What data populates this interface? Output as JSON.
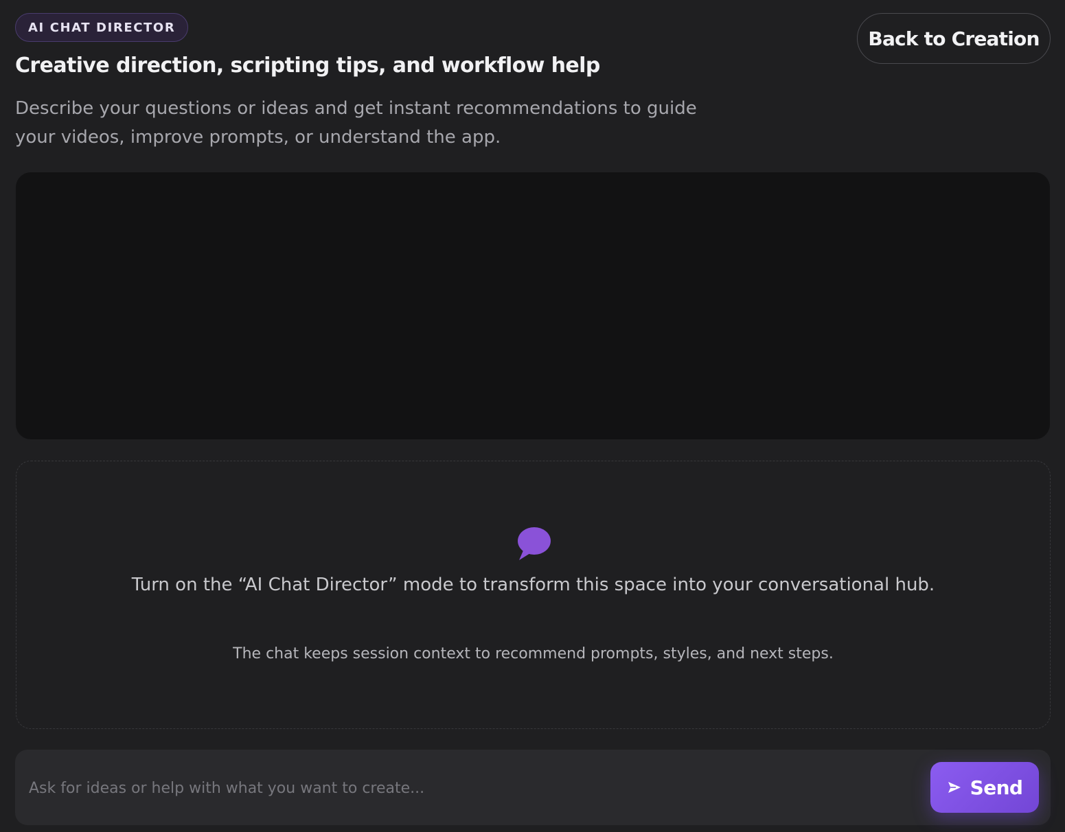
{
  "header": {
    "badge": "AI CHAT DIRECTOR",
    "title": "Creative direction, scripting tips, and workflow help",
    "description": "Describe your questions or ideas and get instant recommendations to guide your videos, improve prompts, or understand the app.",
    "back_button": "Back to Creation"
  },
  "chat_empty_state": {
    "icon": "chat-bubble-icon",
    "message": "Turn on the “AI Chat Director” mode to transform this space into your conversational hub.",
    "submessage": "The chat keeps session context to recommend prompts, styles, and next steps."
  },
  "composer": {
    "placeholder": "Ask for ideas or help with what you want to create...",
    "value": "",
    "send_label": "Send",
    "send_icon": "send-arrow-icon"
  },
  "colors": {
    "background": "#1f1f21",
    "preview_panel": "#121213",
    "accent": "#8b5cf0",
    "badge_border": "#4a3c6e"
  }
}
